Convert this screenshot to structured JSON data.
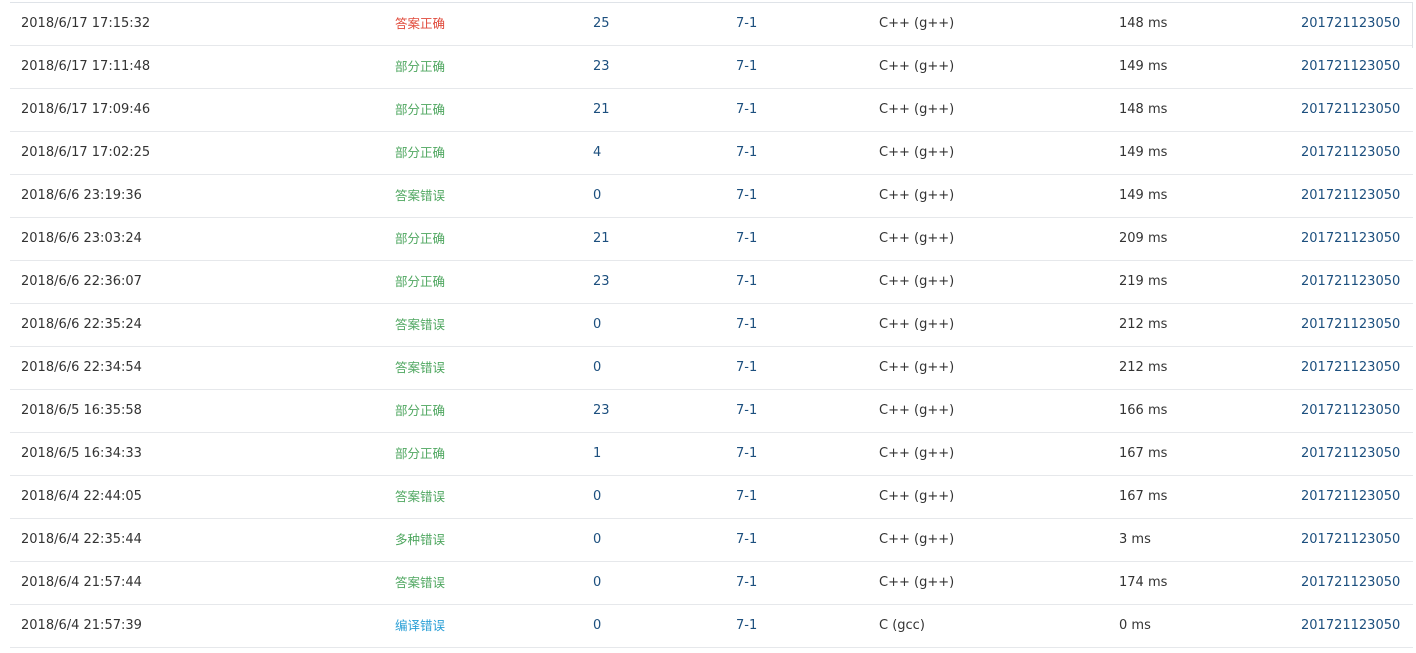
{
  "colors": {
    "accepted": "#e04a3b",
    "wrong": "#4fa760",
    "compile_error": "#2a9fd6",
    "link": "#1c4f7e"
  },
  "submissions": [
    {
      "time": "2018/6/17 17:15:32",
      "status": "答案正确",
      "status_type": "ac",
      "score": "25",
      "problem": "7-1",
      "compiler": "C++ (g++)",
      "time_cost": "148 ms",
      "user": "201721123050"
    },
    {
      "time": "2018/6/17 17:11:48",
      "status": "部分正确",
      "status_type": "green",
      "score": "23",
      "problem": "7-1",
      "compiler": "C++ (g++)",
      "time_cost": "149 ms",
      "user": "201721123050"
    },
    {
      "time": "2018/6/17 17:09:46",
      "status": "部分正确",
      "status_type": "green",
      "score": "21",
      "problem": "7-1",
      "compiler": "C++ (g++)",
      "time_cost": "148 ms",
      "user": "201721123050"
    },
    {
      "time": "2018/6/17 17:02:25",
      "status": "部分正确",
      "status_type": "green",
      "score": "4",
      "problem": "7-1",
      "compiler": "C++ (g++)",
      "time_cost": "149 ms",
      "user": "201721123050"
    },
    {
      "time": "2018/6/6 23:19:36",
      "status": "答案错误",
      "status_type": "green",
      "score": "0",
      "problem": "7-1",
      "compiler": "C++ (g++)",
      "time_cost": "149 ms",
      "user": "201721123050"
    },
    {
      "time": "2018/6/6 23:03:24",
      "status": "部分正确",
      "status_type": "green",
      "score": "21",
      "problem": "7-1",
      "compiler": "C++ (g++)",
      "time_cost": "209 ms",
      "user": "201721123050"
    },
    {
      "time": "2018/6/6 22:36:07",
      "status": "部分正确",
      "status_type": "green",
      "score": "23",
      "problem": "7-1",
      "compiler": "C++ (g++)",
      "time_cost": "219 ms",
      "user": "201721123050"
    },
    {
      "time": "2018/6/6 22:35:24",
      "status": "答案错误",
      "status_type": "green",
      "score": "0",
      "problem": "7-1",
      "compiler": "C++ (g++)",
      "time_cost": "212 ms",
      "user": "201721123050"
    },
    {
      "time": "2018/6/6 22:34:54",
      "status": "答案错误",
      "status_type": "green",
      "score": "0",
      "problem": "7-1",
      "compiler": "C++ (g++)",
      "time_cost": "212 ms",
      "user": "201721123050"
    },
    {
      "time": "2018/6/5 16:35:58",
      "status": "部分正确",
      "status_type": "green",
      "score": "23",
      "problem": "7-1",
      "compiler": "C++ (g++)",
      "time_cost": "166 ms",
      "user": "201721123050"
    },
    {
      "time": "2018/6/5 16:34:33",
      "status": "部分正确",
      "status_type": "green",
      "score": "1",
      "problem": "7-1",
      "compiler": "C++ (g++)",
      "time_cost": "167 ms",
      "user": "201721123050"
    },
    {
      "time": "2018/6/4 22:44:05",
      "status": "答案错误",
      "status_type": "green",
      "score": "0",
      "problem": "7-1",
      "compiler": "C++ (g++)",
      "time_cost": "167 ms",
      "user": "201721123050"
    },
    {
      "time": "2018/6/4 22:35:44",
      "status": "多种错误",
      "status_type": "green",
      "score": "0",
      "problem": "7-1",
      "compiler": "C++ (g++)",
      "time_cost": "3 ms",
      "user": "201721123050"
    },
    {
      "time": "2018/6/4 21:57:44",
      "status": "答案错误",
      "status_type": "green",
      "score": "0",
      "problem": "7-1",
      "compiler": "C++ (g++)",
      "time_cost": "174 ms",
      "user": "201721123050"
    },
    {
      "time": "2018/6/4 21:57:39",
      "status": "编译错误",
      "status_type": "blue",
      "score": "0",
      "problem": "7-1",
      "compiler": "C (gcc)",
      "time_cost": "0 ms",
      "user": "201721123050"
    }
  ]
}
